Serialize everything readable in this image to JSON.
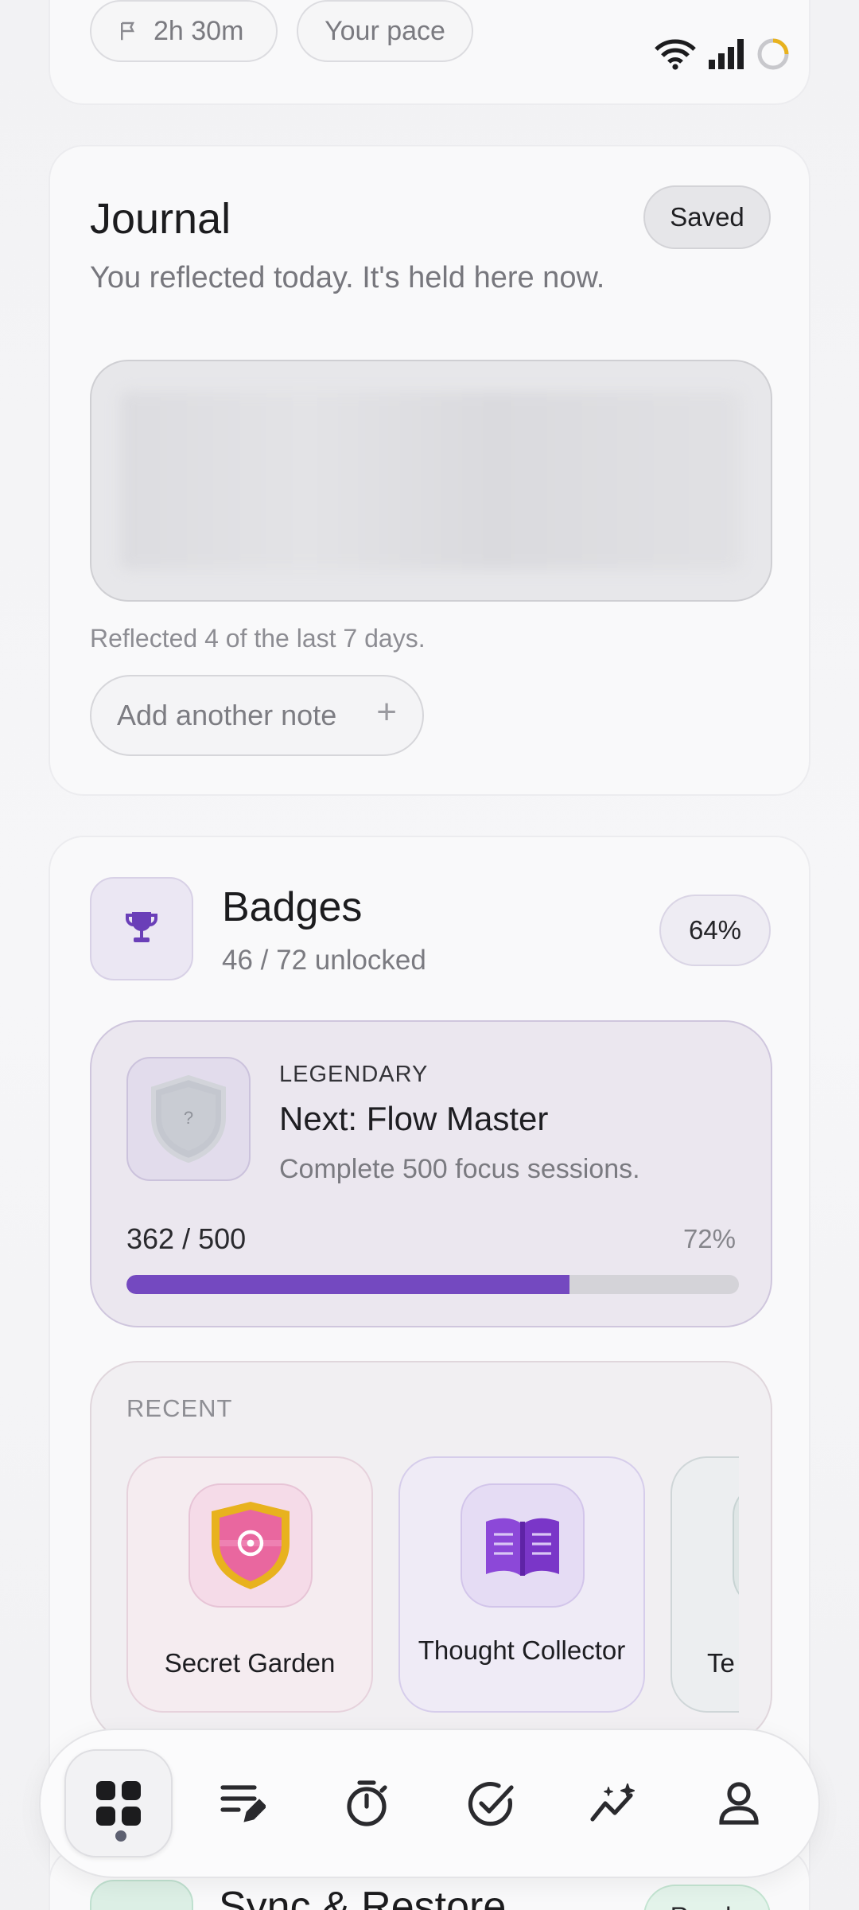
{
  "top_card": {
    "duration_chip": "2h 30m",
    "pace_chip": "Your pace"
  },
  "journal": {
    "title": "Journal",
    "status_pill": "Saved",
    "subtitle": "You reflected today. It's held here now.",
    "stat": "Reflected 4 of the last 7 days.",
    "add_button": "Add another note",
    "add_icon": "+"
  },
  "badges": {
    "title": "Badges",
    "subtitle": "46 / 72 unlocked",
    "percent_pill": "64%",
    "next": {
      "rarity": "LEGENDARY",
      "title": "Next: Flow Master",
      "description": "Complete 500 focus sessions.",
      "progress_count": "362 / 500",
      "progress_percent": "72%",
      "progress_fraction": 0.724,
      "locked_glyph": "?"
    },
    "recent": {
      "label": "RECENT",
      "items": [
        {
          "name": "Secret Garden",
          "icon": "shield-target-icon"
        },
        {
          "name": "Thought Collector",
          "icon": "open-book-icon"
        },
        {
          "name": "Te",
          "icon": "badge-icon"
        }
      ]
    }
  },
  "sync": {
    "title": "Sync & Restore",
    "status_pill": "Ready"
  },
  "nav": {
    "items": [
      {
        "id": "dashboard",
        "icon": "grid-icon",
        "active": true
      },
      {
        "id": "journal",
        "icon": "notes-edit-icon",
        "active": false
      },
      {
        "id": "timer",
        "icon": "stopwatch-icon",
        "active": false
      },
      {
        "id": "tasks",
        "icon": "check-circle-icon",
        "active": false
      },
      {
        "id": "insights",
        "icon": "sparkle-chart-icon",
        "active": false
      },
      {
        "id": "profile",
        "icon": "person-icon",
        "active": false
      }
    ]
  },
  "colors": {
    "accent": "#7449c0",
    "track": "#d4d3d8",
    "ready_green": "#e3f3ea",
    "gold": "#e8b21e"
  }
}
